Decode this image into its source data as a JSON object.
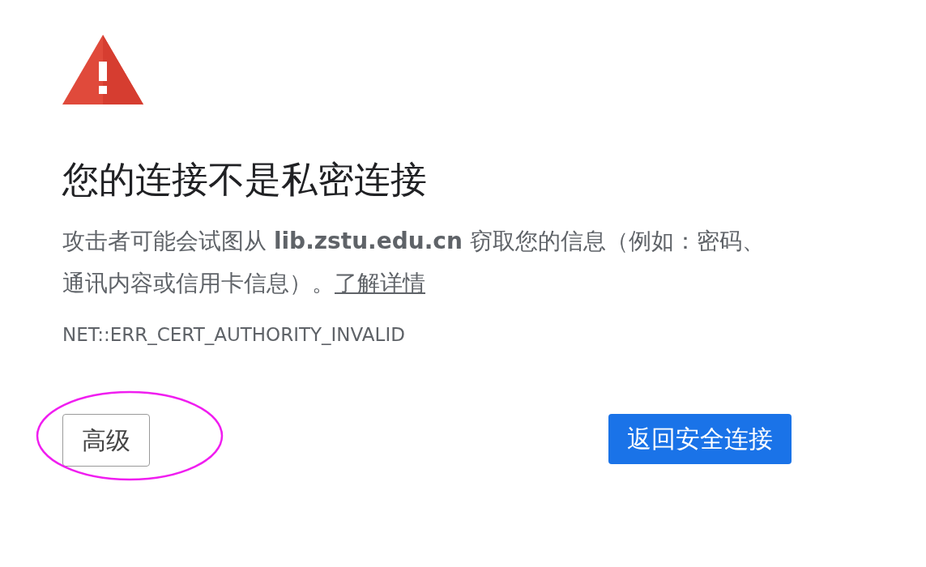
{
  "heading": "您的连接不是私密连接",
  "description": "攻击者可能会试图从 **lib.zstu.edu.cn** 窃取您的信息（例如：密码、通讯内容或信用卡信息）。",
  "learn_more_link": "了解详情",
  "error_code": "NET::ERR_CERT_AUTHORITY_INVALID",
  "buttons": [
    {
      "kind": "secondary",
      "label": "高级",
      "highlighted": true
    },
    {
      "kind": "primary",
      "label": "返回安全连接",
      "highlighted": false
    }
  ]
}
